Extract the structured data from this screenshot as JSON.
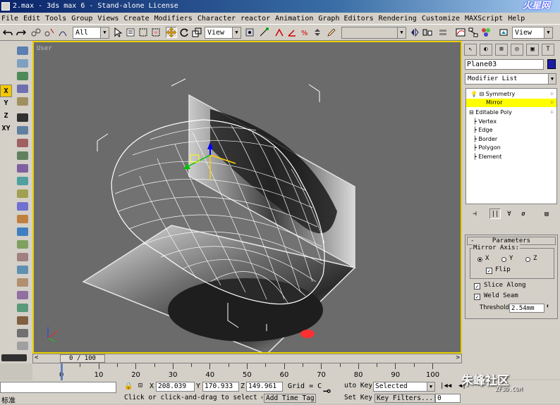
{
  "window": {
    "title": "2.max - 3ds max 6 - Stand-alone License",
    "logo_text": "火星网"
  },
  "menu": [
    "File",
    "Edit",
    "Tools",
    "Group",
    "Views",
    "Create",
    "Modifiers",
    "Character",
    "reactor",
    "Animation",
    "Graph Editors",
    "Rendering",
    "Customize",
    "MAXScript",
    "Help"
  ],
  "toolbar": {
    "selection_filter": "All",
    "coord_system": "View",
    "named_selection": "",
    "view_right": "View"
  },
  "axis_constraints": [
    "X",
    "Y",
    "Z",
    "XY"
  ],
  "viewport": {
    "label": "User"
  },
  "command_panel": {
    "object_name": "Plane03",
    "object_color": "#1c1ca8",
    "modifier_list": "Modifier List",
    "stack": [
      {
        "label": "Symmetry",
        "level": 0
      },
      {
        "label": "Mirror",
        "level": 1,
        "highlighted": true
      },
      {
        "label": "Editable Poly",
        "level": 0
      },
      {
        "label": "Vertex",
        "level": 1
      },
      {
        "label": "Edge",
        "level": 1
      },
      {
        "label": "Border",
        "level": 1
      },
      {
        "label": "Polygon",
        "level": 1
      },
      {
        "label": "Element",
        "level": 1
      }
    ],
    "parameters": {
      "title": "Parameters",
      "mirror_axis_label": "Mirror Axis:",
      "axis_x": "X",
      "axis_y": "Y",
      "axis_z": "Z",
      "selected_axis": "X",
      "flip": "Flip",
      "slice_along": "Slice Along",
      "weld_seam": "Weld Seam",
      "threshold_label": "Threshold:",
      "threshold_value": "2.54mm"
    }
  },
  "timeline": {
    "slider_label": "0 / 100",
    "ticks": [
      "0",
      "10",
      "20",
      "30",
      "40",
      "50",
      "60",
      "70",
      "80",
      "90",
      "100"
    ]
  },
  "status": {
    "lang": "标准",
    "x_value": "208.039",
    "y_value": "170.933",
    "z_value": "149.961",
    "grid": "Grid = C",
    "prompt": "Click or click-and-drag to select ol",
    "add_time_tag": "Add Time Tag",
    "auto_key": "uto Key",
    "set_key": "Set Key",
    "selected": "Selected",
    "key_filters": "Key Filters...",
    "frame": "0"
  },
  "watermark": {
    "site": "朱峰社区",
    "url": "ZF3D.COM"
  }
}
